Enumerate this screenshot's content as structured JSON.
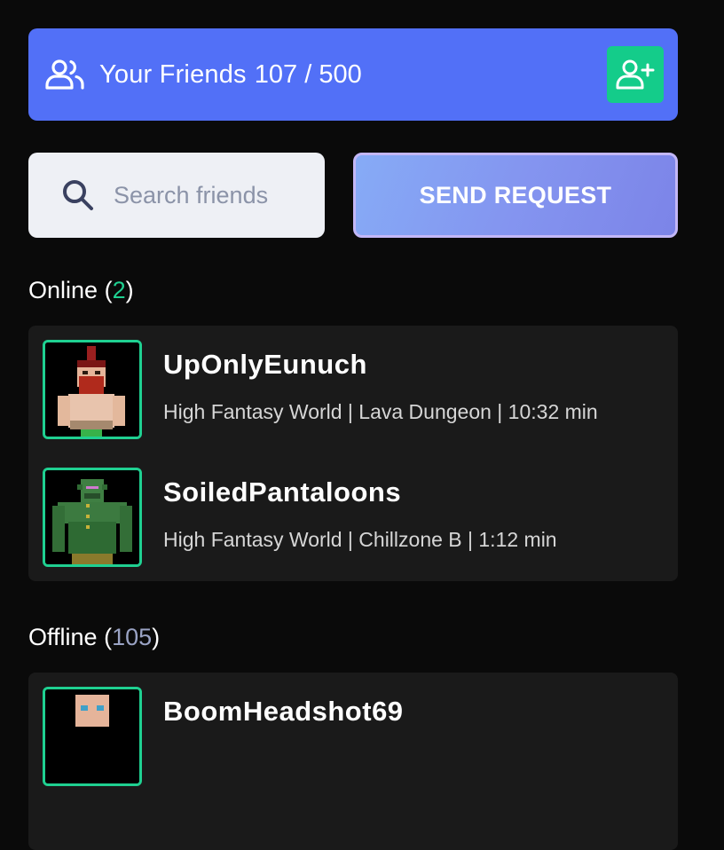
{
  "header": {
    "title": "Your Friends",
    "count": "107 / 500",
    "icons": {
      "friends": "users-icon",
      "add": "user-plus-icon"
    }
  },
  "search": {
    "placeholder": "Search friends",
    "value": ""
  },
  "send_request": {
    "label": "SEND REQUEST"
  },
  "online": {
    "label": "Online",
    "count": "2",
    "friends": [
      {
        "name": "UpOnlyEunuch",
        "status": "High Fantasy World | Lava Dungeon | 10:32 min"
      },
      {
        "name": "SoiledPantaloons",
        "status": "High Fantasy World | Chillzone B | 1:12 min"
      }
    ]
  },
  "offline": {
    "label": "Offline",
    "count": "105",
    "friends": [
      {
        "name": "BoomHeadshot69"
      }
    ]
  },
  "colors": {
    "header_bg": "#5270f7",
    "add_button": "#14cc8a",
    "online_accent": "#1fd091",
    "offline_accent": "#9aa3c4"
  }
}
